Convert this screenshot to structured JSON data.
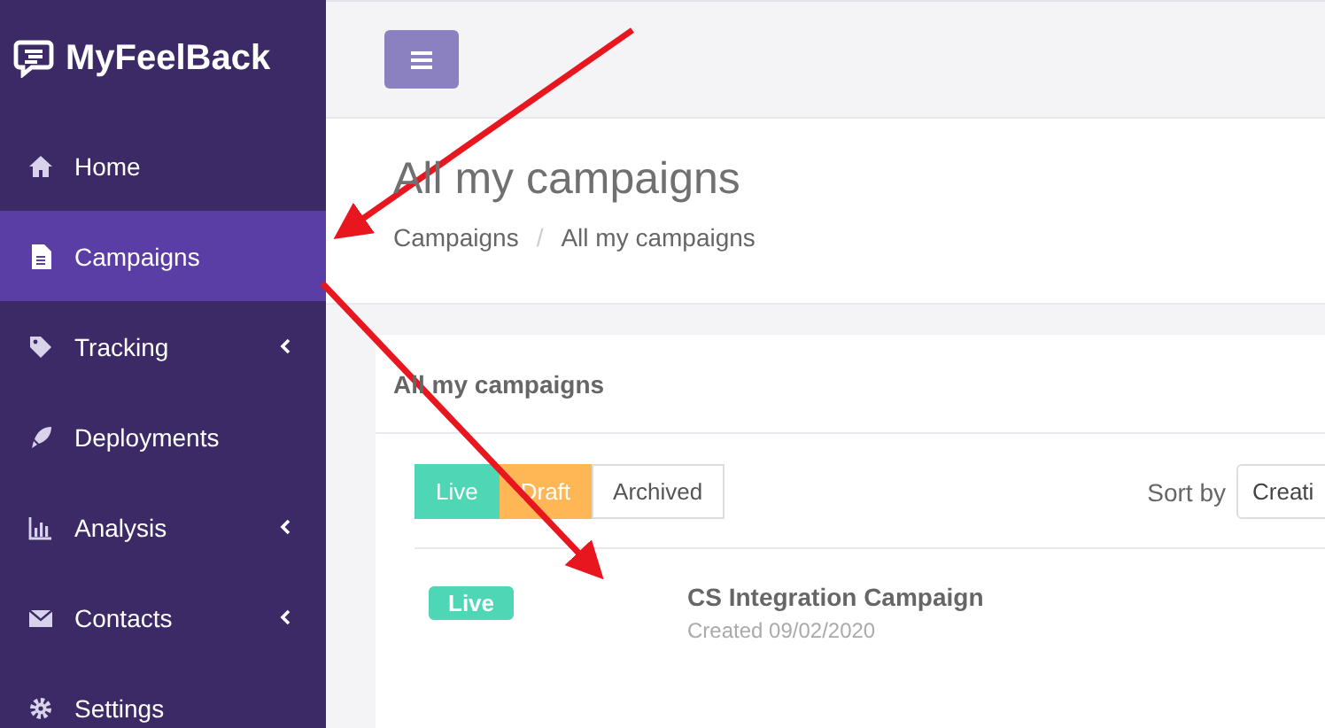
{
  "sidebar": {
    "logo": "MyFeelBack",
    "items": [
      {
        "label": "Home",
        "selected": false,
        "expandable": false
      },
      {
        "label": "Campaigns",
        "selected": true,
        "expandable": false
      },
      {
        "label": "Tracking",
        "selected": false,
        "expandable": true
      },
      {
        "label": "Deployments",
        "selected": false,
        "expandable": false
      },
      {
        "label": "Analysis",
        "selected": false,
        "expandable": true
      },
      {
        "label": "Contacts",
        "selected": false,
        "expandable": true
      },
      {
        "label": "Settings",
        "selected": false,
        "expandable": false
      }
    ]
  },
  "header": {
    "title": "All my campaigns",
    "breadcrumb": [
      "Campaigns",
      "All my campaigns"
    ],
    "breadcrumb_separator": "/"
  },
  "panel": {
    "title": "All my campaigns",
    "filters": [
      {
        "label": "Live",
        "selected": true,
        "color": "#4fd6b5"
      },
      {
        "label": "Draft",
        "selected": true,
        "color": "#ffb655"
      },
      {
        "label": "Archived",
        "selected": false
      }
    ],
    "sort_label": "Sort by",
    "sort_value": "Creati",
    "campaigns": [
      {
        "color": "#4fd6b5",
        "status_label": "Live",
        "name": "CS Integration Campaign",
        "created": "Created 09/02/2020"
      }
    ]
  }
}
